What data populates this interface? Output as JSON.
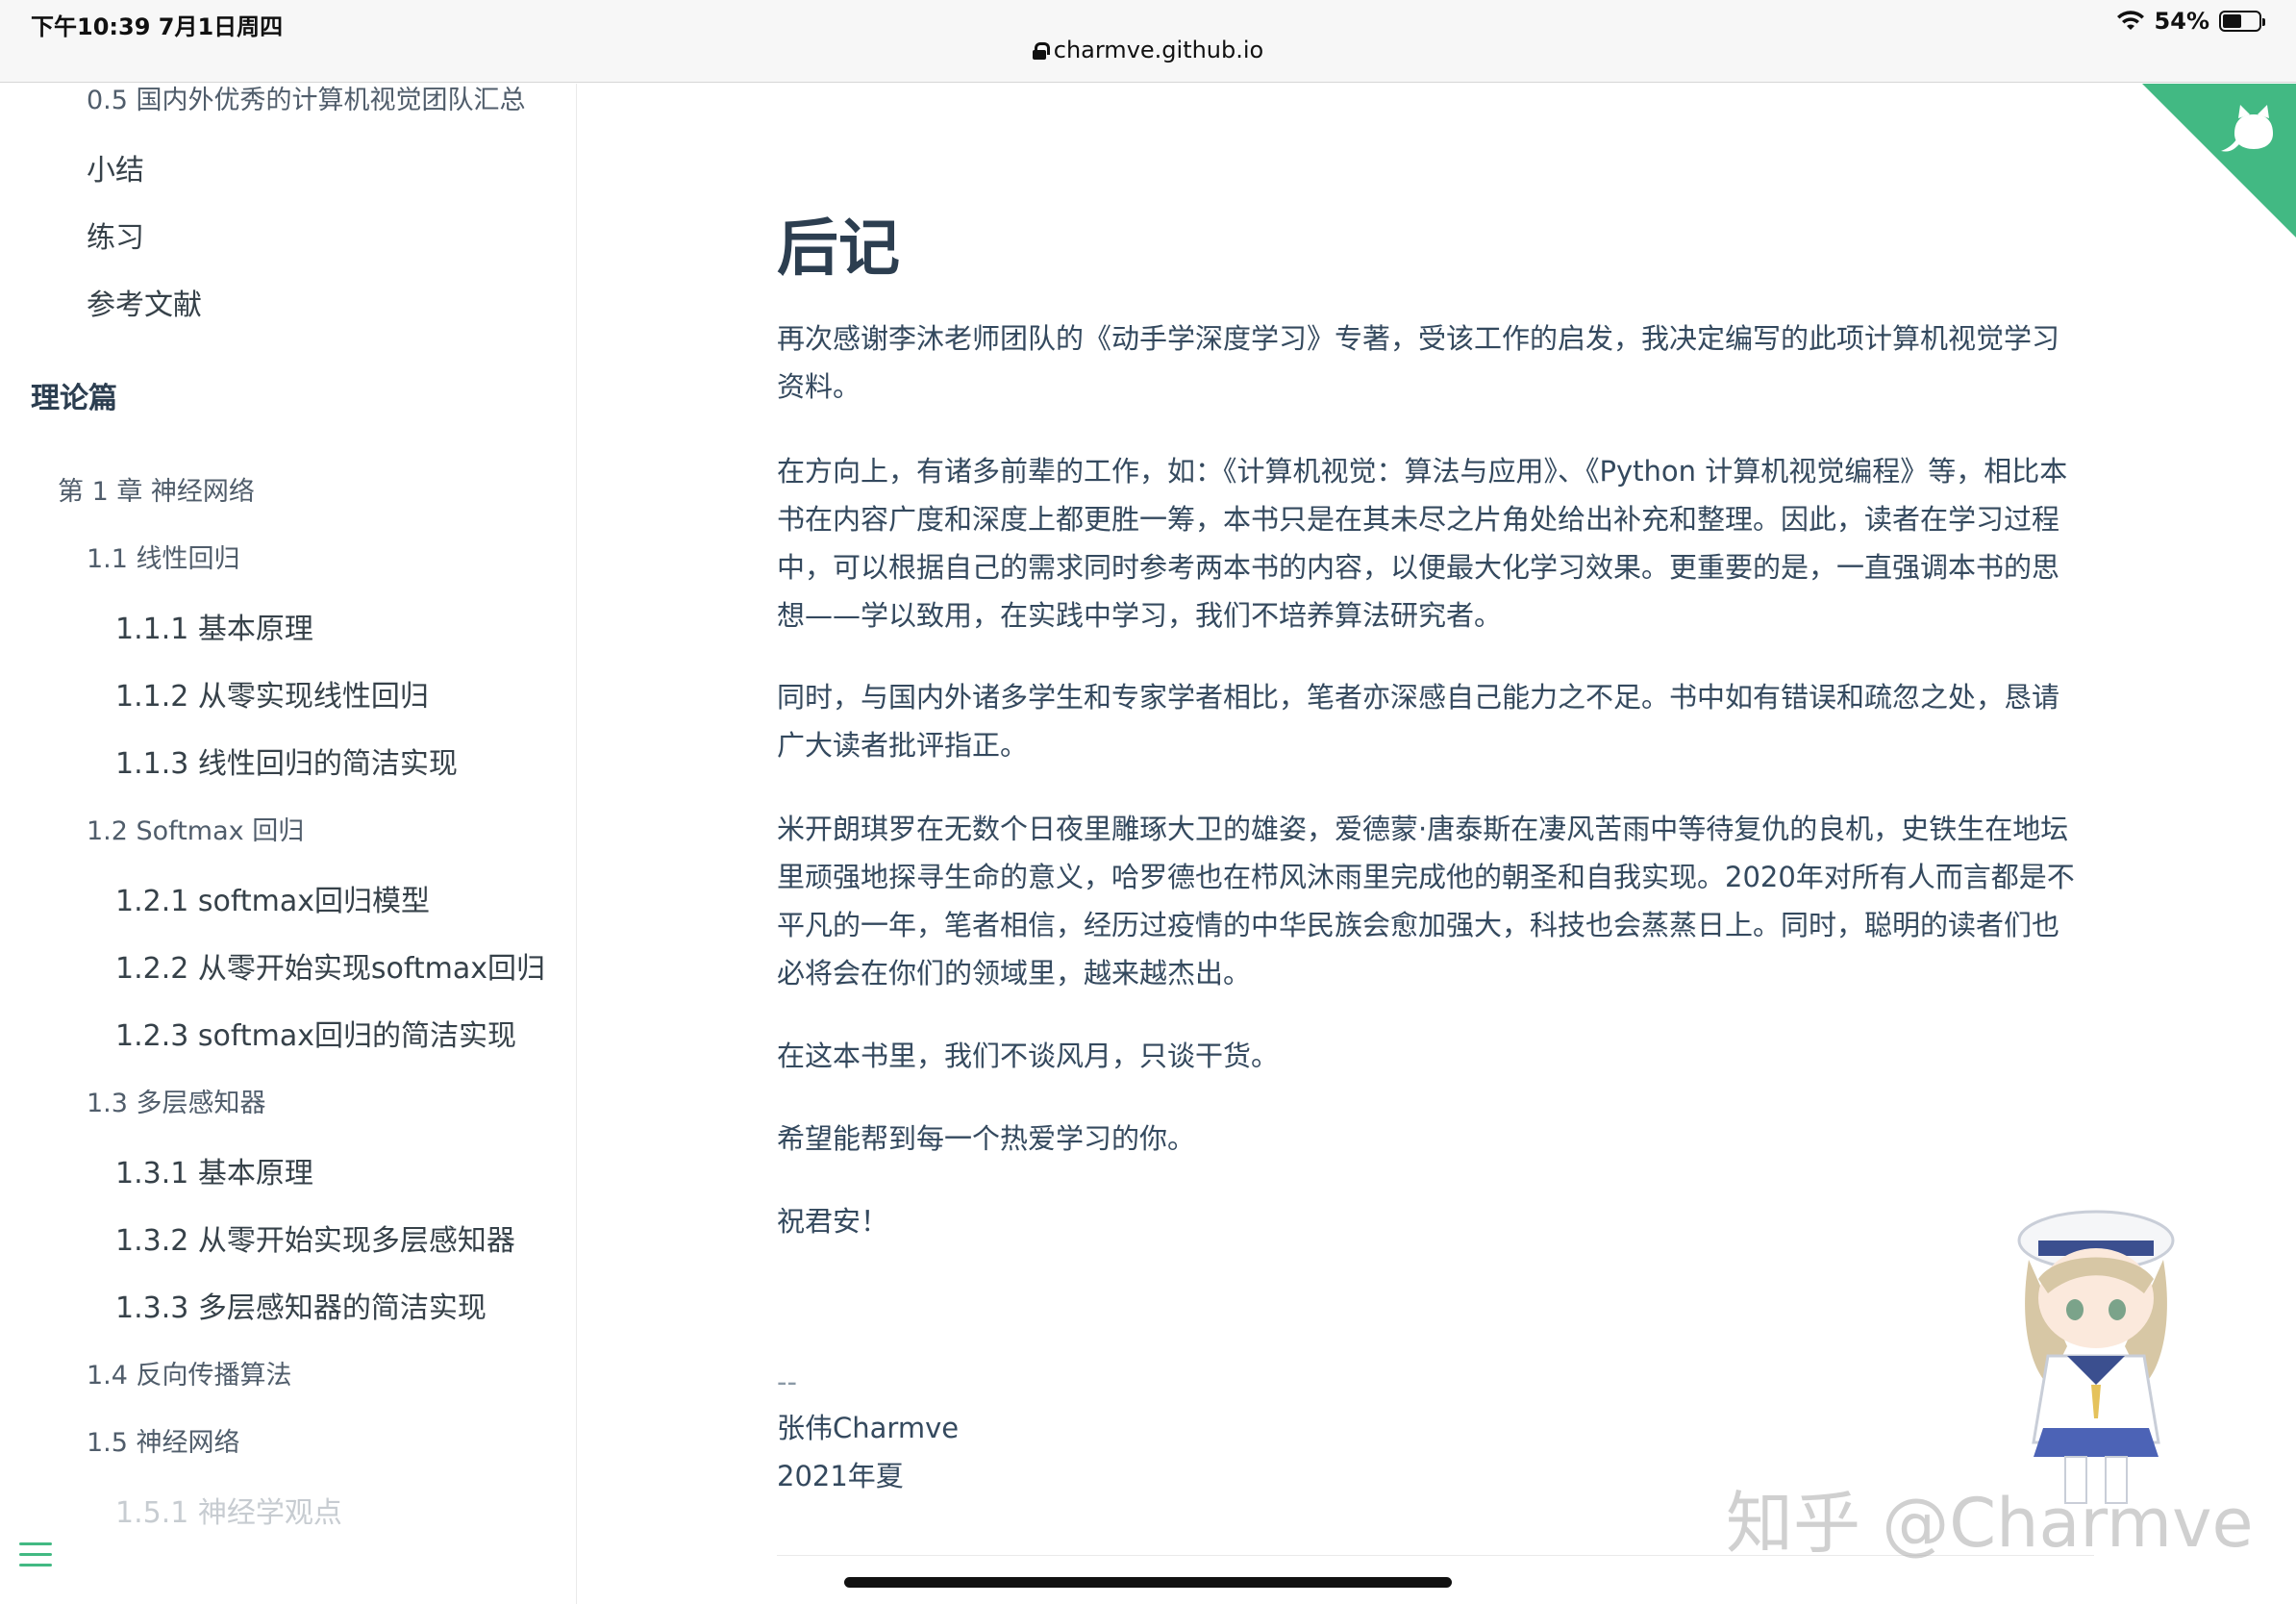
{
  "status": {
    "time": "下午10:39   7月1日周四",
    "battery": "54%",
    "battery_level": 0.54,
    "url": "charmve.github.io"
  },
  "sidebar": {
    "items": [
      {
        "label": "0.5 国内外优秀的计算机视觉团队汇总",
        "level": "lv2"
      },
      {
        "label": "小结",
        "level": "lv2b"
      },
      {
        "label": "练习",
        "level": "lv2b"
      },
      {
        "label": "参考文献",
        "level": "lv2b"
      },
      {
        "label": "理论篇",
        "level": "lv0"
      },
      {
        "label": "第 1 章 神经网络",
        "level": "lv1"
      },
      {
        "label": "1.1 线性回归",
        "level": "lv2"
      },
      {
        "label": "1.1.1 基本原理",
        "level": "lv3"
      },
      {
        "label": "1.1.2 从零实现线性回归",
        "level": "lv3"
      },
      {
        "label": "1.1.3 线性回归的简洁实现",
        "level": "lv3"
      },
      {
        "label": "1.2 Softmax 回归",
        "level": "lv2"
      },
      {
        "label": "1.2.1 softmax回归模型",
        "level": "lv3"
      },
      {
        "label": "1.2.2 从零开始实现softmax回归",
        "level": "lv3"
      },
      {
        "label": "1.2.3 softmax回归的简洁实现",
        "level": "lv3"
      },
      {
        "label": "1.3 多层感知器",
        "level": "lv2"
      },
      {
        "label": "1.3.1 基本原理",
        "level": "lv3"
      },
      {
        "label": "1.3.2 从零开始实现多层感知器",
        "level": "lv3"
      },
      {
        "label": "1.3.3 多层感知器的简洁实现",
        "level": "lv3"
      },
      {
        "label": "1.4 反向传播算法",
        "level": "lv2"
      },
      {
        "label": "1.5 神经网络",
        "level": "lv2"
      },
      {
        "label": "1.5.1 神经学观点",
        "level": "lv3"
      }
    ]
  },
  "article": {
    "title": "后记",
    "paragraphs": [
      "再次感谢李沐老师团队的《动手学深度学习》专著，受该工作的启发，我决定编写的此项计算机视觉学习资料。",
      "在方向上，有诸多前辈的工作，如：《计算机视觉：算法与应用》、《Python 计算机视觉编程》等，相比本书在内容广度和深度上都更胜一筹，本书只是在其未尽之片角处给出补充和整理。因此，读者在学习过程中，可以根据自己的需求同时参考两本书的内容，以便最大化学习效果。更重要的是，一直强调本书的思想——学以致用，在实践中学习，我们不培养算法研究者。",
      "同时，与国内外诸多学生和专家学者相比，笔者亦深感自己能力之不足。书中如有错误和疏忽之处，恳请广大读者批评指正。",
      "米开朗琪罗在无数个日夜里雕琢大卫的雄姿，爱德蒙·唐泰斯在凄风苦雨中等待复仇的良机，史铁生在地坛里顽强地探寻生命的意义，哈罗德也在栉风沐雨里完成他的朝圣和自我实现。2020年对所有人而言都是不平凡的一年，笔者相信，经历过疫情的中华民族会愈加强大，科技也会蒸蒸日上。同时，聪明的读者们也必将会在你们的领域里，越来越杰出。",
      "在这本书里，我们不谈风月，只谈干货。",
      "希望能帮到每一个热爱学习的你。",
      "祝君安！"
    ],
    "signature_dash": "--",
    "signature_name": "张伟Charmve",
    "signature_date": "2021年夏"
  },
  "watermark": "知乎 @Charmve",
  "colors": {
    "accent": "#42b983",
    "text": "#34495e",
    "title": "#2c3e50"
  }
}
